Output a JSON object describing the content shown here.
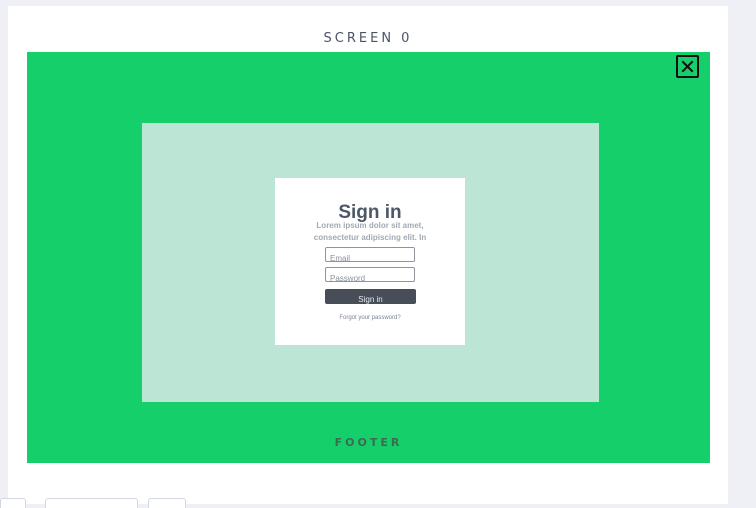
{
  "screen": {
    "title": "SCREEN 0"
  },
  "modal": {
    "close_icon": "close-icon",
    "signin": {
      "title": "Sign in",
      "description": "Lorem ipsum dolor sit amet, consectetur adipiscing elit. In",
      "email_placeholder": "Email",
      "password_placeholder": "Password",
      "button_label": "Sign in",
      "forgot_password": "Forgot your password?"
    },
    "footer_label": "FOOTER"
  },
  "colors": {
    "page_background": "#eef0f5",
    "green_area": "#15cf6a",
    "light_panel": "#bce5d6",
    "button": "#474e58"
  }
}
